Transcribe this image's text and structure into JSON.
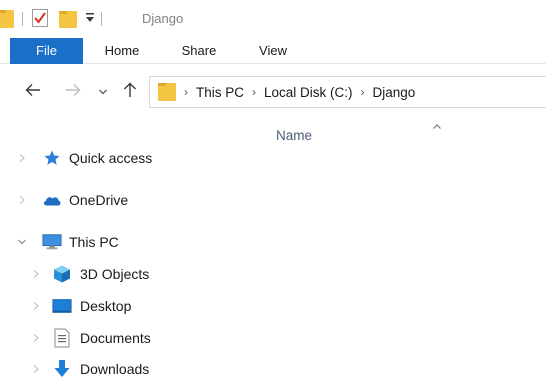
{
  "window": {
    "title": "Django"
  },
  "ribbon": {
    "tabs": [
      {
        "label": "File"
      },
      {
        "label": "Home"
      },
      {
        "label": "Share"
      },
      {
        "label": "View"
      }
    ]
  },
  "address": {
    "crumbs": [
      "This PC",
      "Local Disk (C:)",
      "Django"
    ]
  },
  "content": {
    "name_column": "Name"
  },
  "nav_pane": {
    "quick_access": "Quick access",
    "onedrive": "OneDrive",
    "this_pc": "This PC",
    "children": [
      "3D Objects",
      "Desktop",
      "Documents",
      "Downloads"
    ]
  },
  "colors": {
    "accent": "#1a6fc9",
    "folder": "#f4c542"
  }
}
